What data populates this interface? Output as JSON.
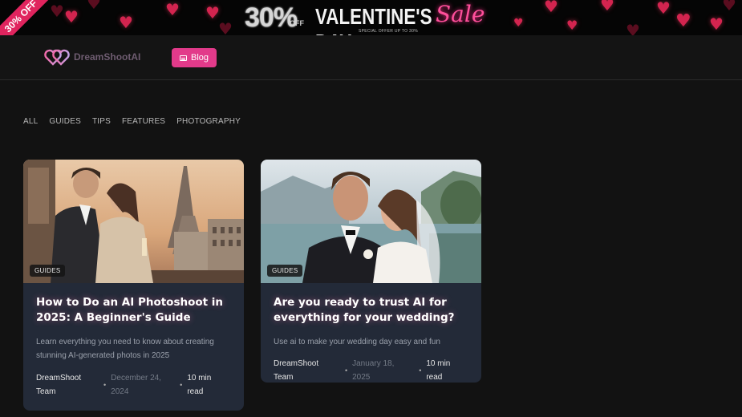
{
  "banner": {
    "ribbon": "30% OFF",
    "percent": "30%",
    "off": "OFF",
    "title": "VALENTINE'S DAY",
    "sale": "Sale",
    "subtext": "SPECIAL OFFER UP TO 30%"
  },
  "header": {
    "logo_text": "DreamShootAI",
    "blog_button": "Blog"
  },
  "tabs": [
    "ALL",
    "GUIDES",
    "TIPS",
    "FEATURES",
    "PHOTOGRAPHY"
  ],
  "posts": [
    {
      "badge": "GUIDES",
      "title": "How to Do an AI Photoshoot in 2025: A Beginner's Guide",
      "description": "Learn everything you need to know about creating stunning AI-generated photos in 2025",
      "author": "DreamShoot Team",
      "date": "December 24, 2024",
      "read_time": "10 min read"
    },
    {
      "badge": "GUIDES",
      "title": "Are you ready to trust AI for everything for your wedding?",
      "description": "Use ai to make your wedding day easy and fun",
      "author": "DreamShoot Team",
      "date": "January 18, 2025",
      "read_time": "10 min read"
    }
  ],
  "colors": {
    "accent": "#e23a8a",
    "card_bg": "#232a38",
    "page_bg": "#121212"
  }
}
